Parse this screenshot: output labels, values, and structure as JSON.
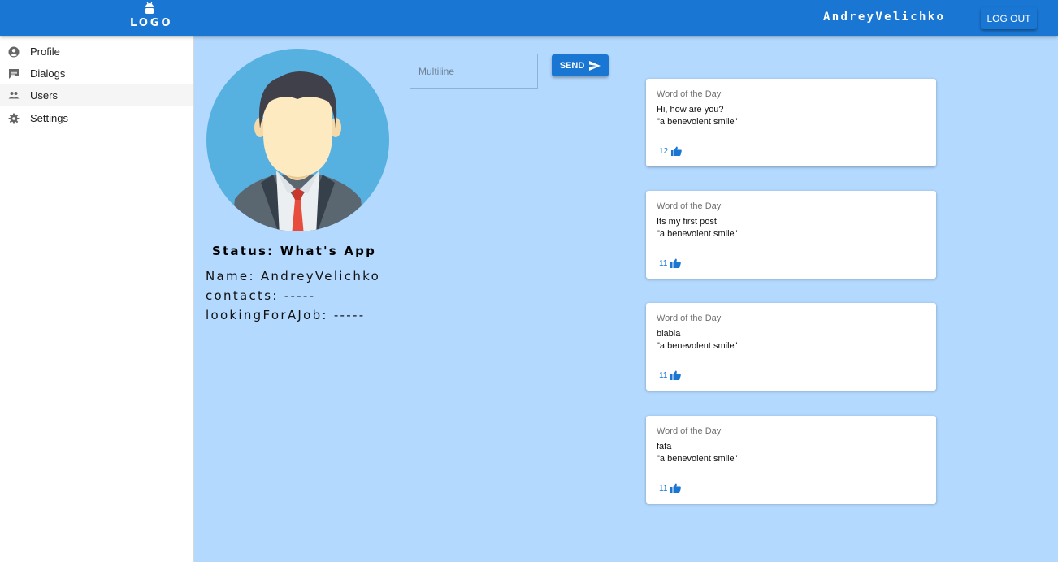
{
  "header": {
    "logo_text": "LOGO",
    "username": "AndreyVelichko",
    "logout_label": "LOG OUT"
  },
  "sidebar": {
    "items": [
      {
        "label": "Profile",
        "icon": "account-circle-icon"
      },
      {
        "label": "Dialogs",
        "icon": "chat-icon"
      },
      {
        "label": "Users",
        "icon": "people-icon",
        "active": true
      },
      {
        "label": "Settings",
        "icon": "gear-icon"
      }
    ]
  },
  "profile": {
    "status": "Status: What's App",
    "name": "Name: AndreyVelichko",
    "contacts": "contacts: -----",
    "looking_for_job": "lookingForAJob: -----"
  },
  "post_form": {
    "placeholder": "Multiline",
    "send_label": "SEND"
  },
  "posts": [
    {
      "subtitle": "Word of the Day",
      "message": "Hi, how are you?",
      "quote": "\"a benevolent smile\"",
      "likes": "12"
    },
    {
      "subtitle": "Word of the Day",
      "message": "Its my first post",
      "quote": "\"a benevolent smile\"",
      "likes": "11"
    },
    {
      "subtitle": "Word of the Day",
      "message": "blabla",
      "quote": "\"a benevolent smile\"",
      "likes": "11"
    },
    {
      "subtitle": "Word of the Day",
      "message": "fafa",
      "quote": "\"a benevolent smile\"",
      "likes": "11"
    }
  ],
  "colors": {
    "primary": "#1976d2",
    "background": "#b3d9ff",
    "avatar_bg": "#56b0e0",
    "tie": "#e84c3d"
  }
}
